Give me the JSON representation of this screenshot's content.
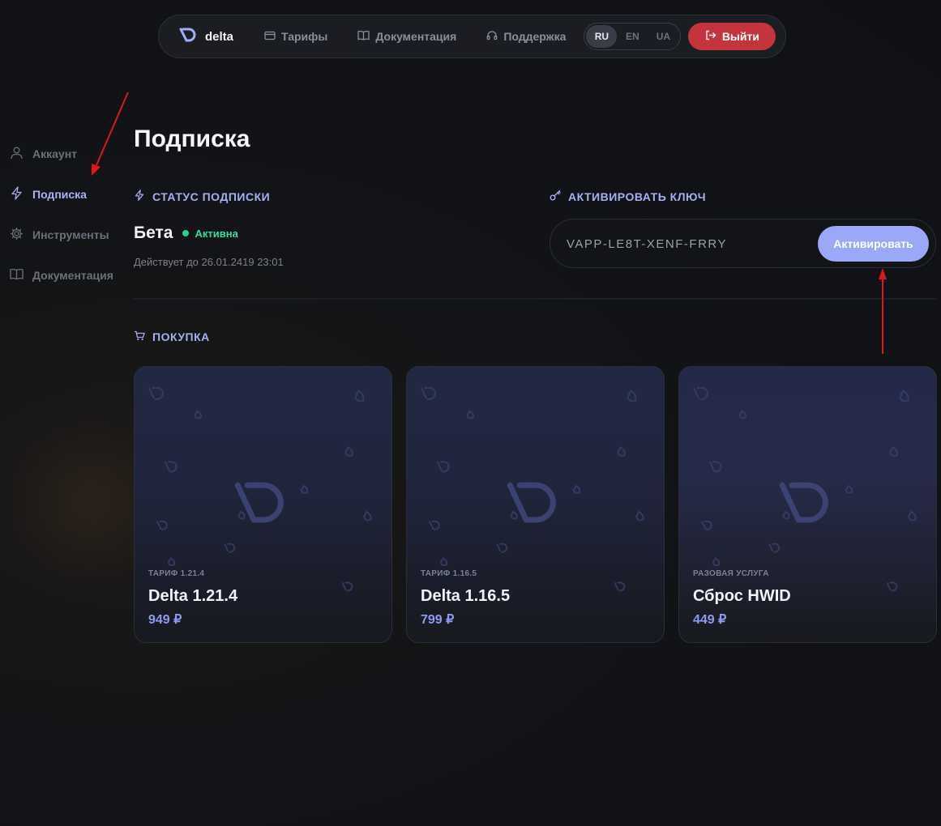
{
  "brand": {
    "name": "delta"
  },
  "nav": {
    "links": [
      {
        "label": "Тарифы",
        "icon": "card-icon"
      },
      {
        "label": "Документация",
        "icon": "book-icon"
      },
      {
        "label": "Поддержка",
        "icon": "headset-icon"
      }
    ],
    "languages": [
      "RU",
      "EN",
      "UA"
    ],
    "active_language": "RU",
    "logout_label": "Выйти"
  },
  "sidebar": {
    "items": [
      {
        "label": "Аккаунт",
        "icon": "user-icon",
        "active": false
      },
      {
        "label": "Подписка",
        "icon": "lightning-icon",
        "active": true
      },
      {
        "label": "Инструменты",
        "icon": "gear-icon",
        "active": false
      },
      {
        "label": "Документация",
        "icon": "book-icon",
        "active": false
      }
    ]
  },
  "main": {
    "title": "Подписка",
    "status_section": {
      "heading": "СТАТУС ПОДПИСКИ",
      "plan": "Бета",
      "status": "Активна",
      "valid_until": "Действует до 26.01.2419 23:01"
    },
    "activate_section": {
      "heading": "АКТИВИРОВАТЬ КЛЮЧ",
      "key_value": "VAPP-LE8T-XENF-FRRY",
      "button": "Активировать"
    },
    "purchase_section": {
      "heading": "ПОКУПКА",
      "cards": [
        {
          "label": "ТАРИФ 1.21.4",
          "title": "Delta 1.21.4",
          "price": "949 ₽"
        },
        {
          "label": "ТАРИФ 1.16.5",
          "title": "Delta 1.16.5",
          "price": "799 ₽"
        },
        {
          "label": "РАЗОВАЯ УСЛУГА",
          "title": "Сброс HWID",
          "price": "449 ₽"
        }
      ]
    }
  },
  "colors": {
    "accent": "#a5b0f3",
    "danger": "#c4343c",
    "success": "#22d38a",
    "annotation_arrow": "#e0161d"
  }
}
